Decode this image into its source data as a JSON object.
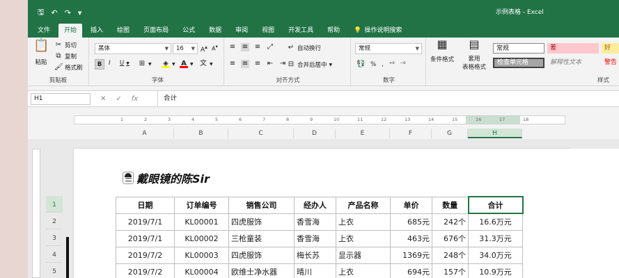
{
  "quick_access": {
    "save": "🖫",
    "undo": "↶",
    "redo": "↷",
    "customize": "▾"
  },
  "window_title": "示例表格 - Excel",
  "tabs": [
    {
      "label": "文件"
    },
    {
      "label": "开始",
      "active": true
    },
    {
      "label": "插入"
    },
    {
      "label": "绘图"
    },
    {
      "label": "页面布局"
    },
    {
      "label": "公式"
    },
    {
      "label": "数据"
    },
    {
      "label": "审阅"
    },
    {
      "label": "视图"
    },
    {
      "label": "开发工具"
    },
    {
      "label": "帮助"
    }
  ],
  "tell_me": "操作说明搜索",
  "ribbon": {
    "clipboard": {
      "paste": "粘贴",
      "cut": "剪切",
      "copy": "复制",
      "format_painter": "格式刷",
      "label": "剪贴板"
    },
    "font": {
      "name": "黑体",
      "size": "16",
      "label": "字体",
      "bold": "B",
      "italic": "I",
      "underline": "U"
    },
    "alignment": {
      "wrap": "自动换行",
      "merge": "合并后居中",
      "label": "对齐方式"
    },
    "number": {
      "format": "常规",
      "label": "数字",
      "percent": "%"
    },
    "styles": {
      "conditional": "条件格式",
      "table_format_1": "套用",
      "table_format_2": "表格格式",
      "normal": "常规",
      "bad": "差",
      "good": "好",
      "check_cell": "检查单元格",
      "explanatory": "解释性文本",
      "warning": "警告",
      "label": "样式"
    }
  },
  "formula_bar": {
    "cell": "H1",
    "content": "合计"
  },
  "ruler_numbers": [
    "1",
    "2",
    "3",
    "4",
    "5",
    "6",
    "7",
    "8",
    "9",
    "10",
    "11",
    "12",
    "13",
    "14",
    "15",
    "16",
    "17",
    "18"
  ],
  "columns": [
    {
      "label": "A"
    },
    {
      "label": "B"
    },
    {
      "label": "C"
    },
    {
      "label": "D"
    },
    {
      "label": "E"
    },
    {
      "label": "F"
    },
    {
      "label": "G"
    },
    {
      "label": "H"
    }
  ],
  "row_numbers": [
    "1",
    "2",
    "3",
    "4",
    "5"
  ],
  "brand": "戴眼镜的陈Sir",
  "table": {
    "headers": [
      "日期",
      "订单编号",
      "销售公司",
      "经办人",
      "产品名称",
      "单价",
      "数量",
      "合计"
    ],
    "rows": [
      [
        "2019/7/1",
        "KL00001",
        "四虎服饰",
        "香雪海",
        "上衣",
        "685元",
        "242个",
        "16.6万元"
      ],
      [
        "2019/7/1",
        "KL00002",
        "三枪童装",
        "香雪海",
        "上衣",
        "463元",
        "676个",
        "31.3万元"
      ],
      [
        "2019/7/2",
        "KL00003",
        "四虎服饰",
        "梅长苏",
        "显示器",
        "1369元",
        "248个",
        "34.0万元"
      ],
      [
        "2019/7/2",
        "KL00004",
        "欧维士净水器",
        "晴川",
        "上衣",
        "694元",
        "157个",
        "10.9万元"
      ]
    ]
  },
  "colors": {
    "accent": "#217346",
    "bad_bg": "#ffc7ce",
    "bad_fg": "#9c0006",
    "good_bg": "#c6efce",
    "good_fg": "#006100",
    "warning_fg": "#ff0000"
  }
}
